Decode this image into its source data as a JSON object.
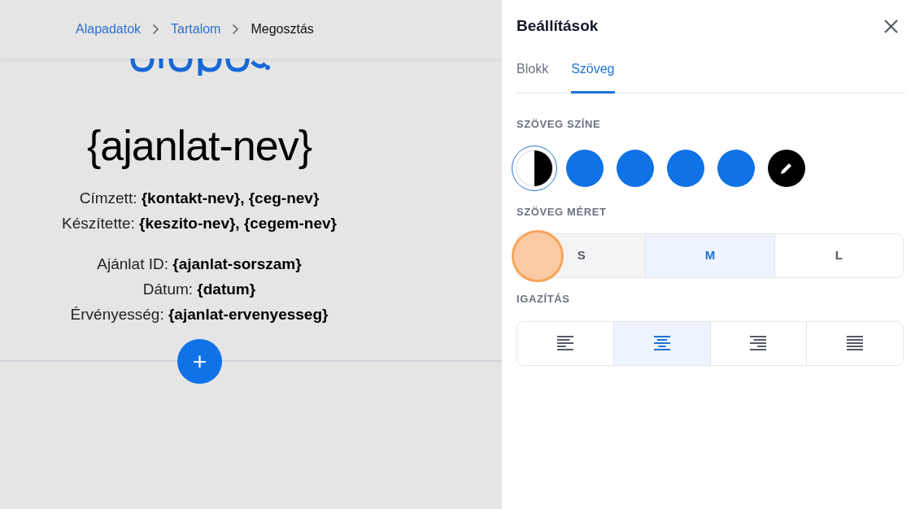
{
  "breadcrumbs": [
    {
      "label": "Alapadatok",
      "current": false
    },
    {
      "label": "Tartalom",
      "current": false
    },
    {
      "label": "Megosztás",
      "current": true
    }
  ],
  "document": {
    "title": "{ajanlat-nev}",
    "groups": [
      [
        "Címzett: **{kontakt-nev}, {ceg-nev}**",
        "Készítette: **{keszito-nev}, {cegem-nev}**"
      ],
      [
        "Ajánlat ID: **{ajanlat-sorszam}**",
        "Dátum: **{datum}**",
        "Érvényesség: **{ajanlat-ervenyesseg}**"
      ]
    ],
    "add_button": "+"
  },
  "settings": {
    "title": "Beállítások",
    "tabs": [
      {
        "label": "Blokk",
        "selected": false
      },
      {
        "label": "Szöveg",
        "selected": true
      }
    ],
    "sections": [
      {
        "kind": "swatches",
        "label": "SZÖVEG SZÍNE",
        "items": [
          {
            "kind": "contrast",
            "selected": true
          },
          {
            "kind": "color",
            "color": "#0f72e6",
            "selected": false
          },
          {
            "kind": "color",
            "color": "#0f72e6",
            "selected": false
          },
          {
            "kind": "color",
            "color": "#0f72e6",
            "selected": false
          },
          {
            "kind": "color",
            "color": "#0f72e6",
            "selected": false
          },
          {
            "kind": "custom",
            "selected": false
          }
        ]
      },
      {
        "kind": "text_options",
        "label": "SZÖVEG MÉRET",
        "items": [
          {
            "label": "S",
            "selected": false
          },
          {
            "label": "M",
            "selected": true
          },
          {
            "label": "L",
            "selected": false
          }
        ]
      },
      {
        "kind": "align_options",
        "label": "IGAZÍTÁS",
        "items": [
          {
            "kind": "left",
            "selected": false
          },
          {
            "kind": "center",
            "selected": true
          },
          {
            "kind": "right",
            "selected": false
          },
          {
            "kind": "justify",
            "selected": false
          }
        ]
      }
    ]
  }
}
